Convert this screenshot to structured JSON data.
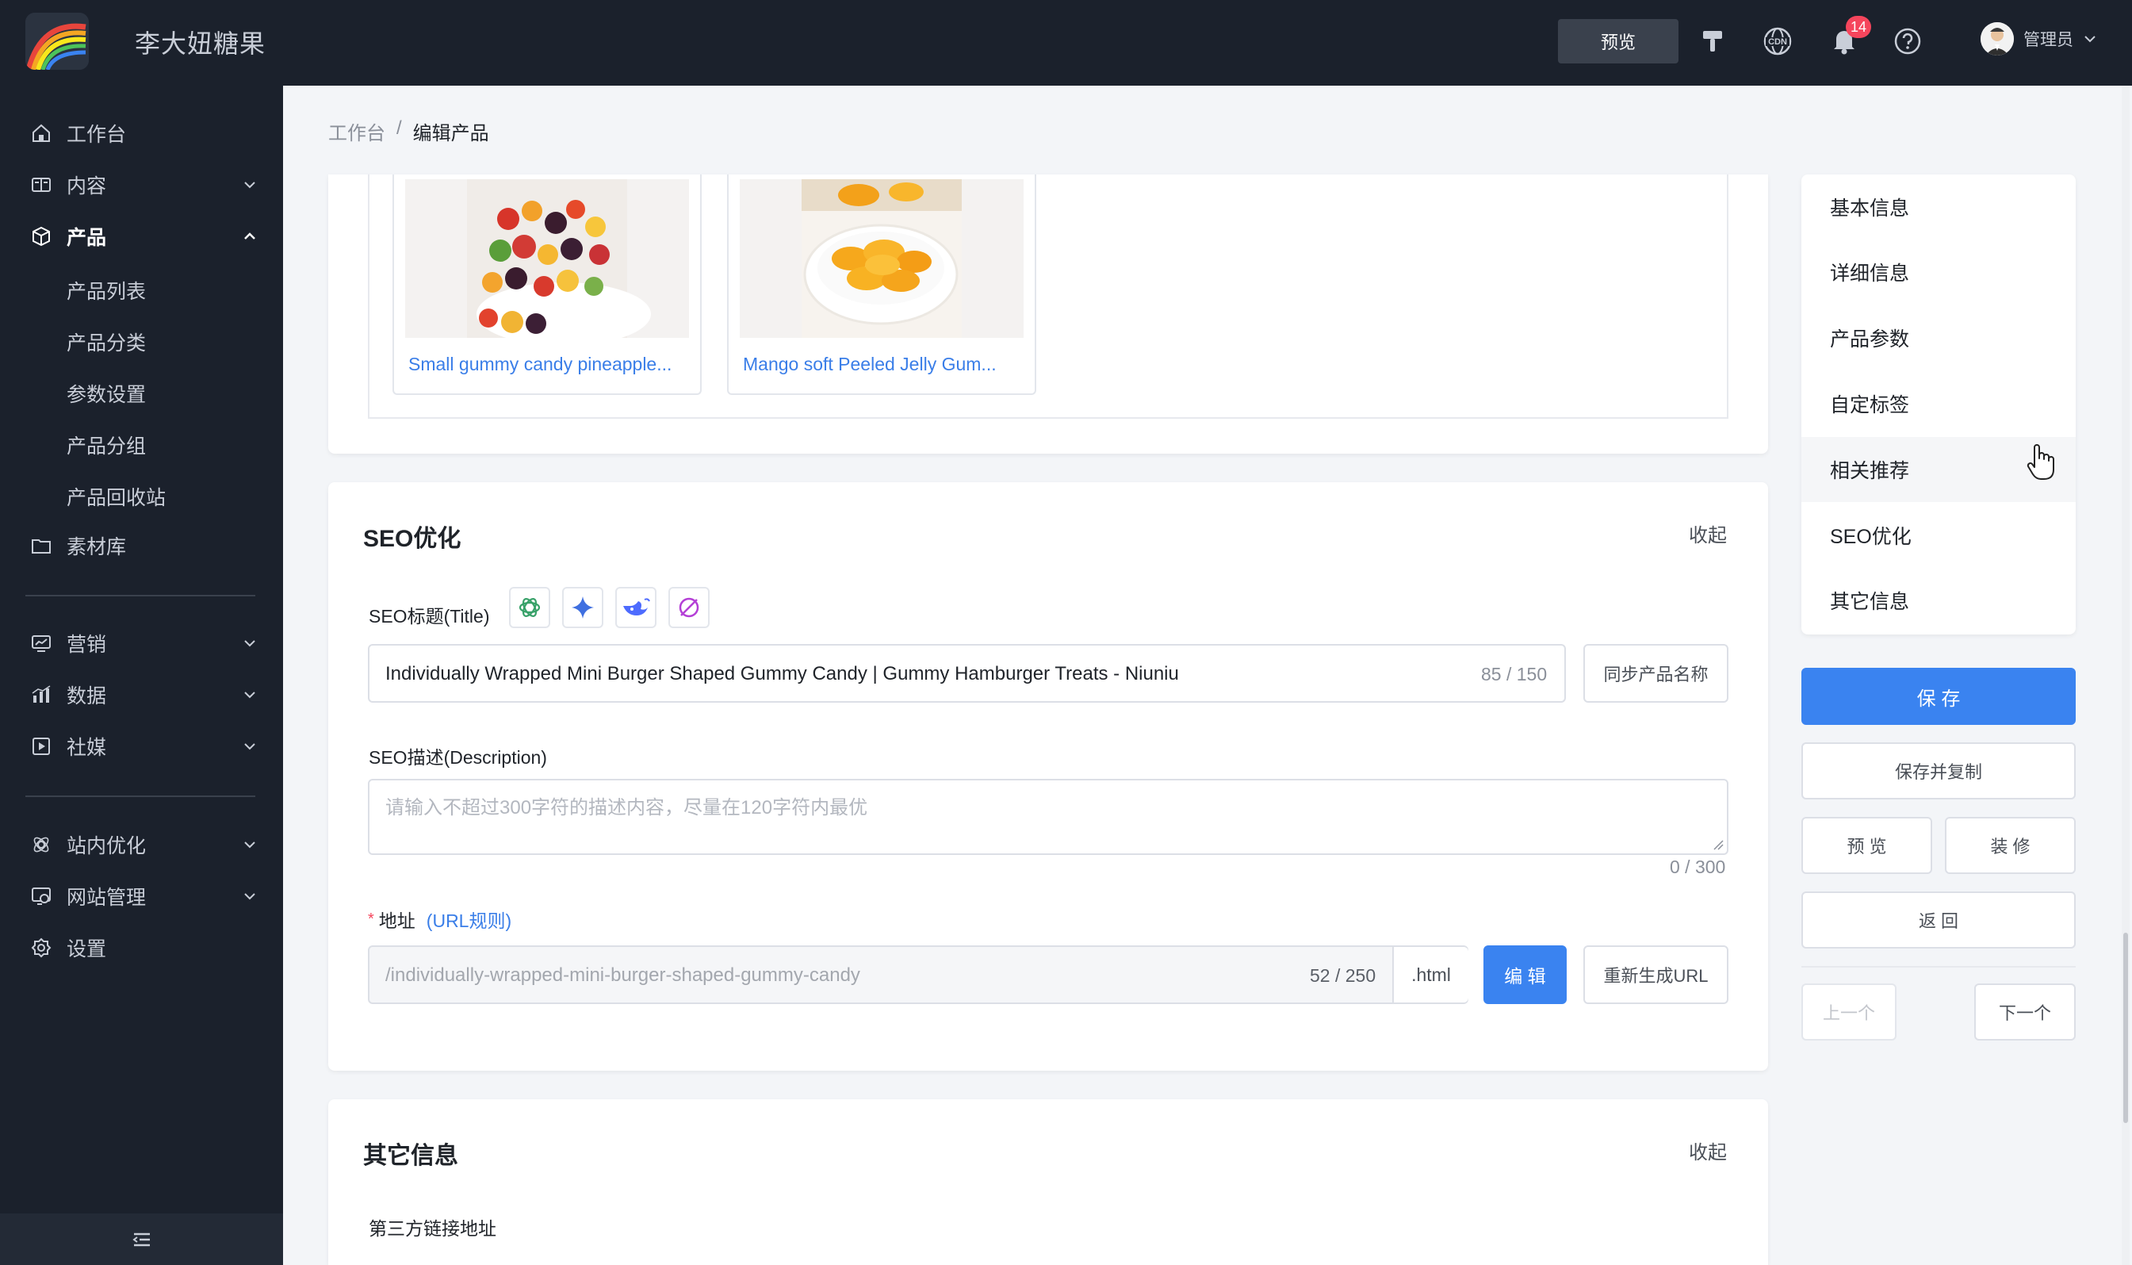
{
  "header": {
    "site_name": "李大妞糖果",
    "preview_label": "预览",
    "cdn_label": "CDN",
    "notification_count": "14",
    "user_name": "管理员"
  },
  "sidebar": {
    "items": [
      {
        "label": "工作台",
        "icon": "home-icon"
      },
      {
        "label": "内容",
        "icon": "content-icon"
      },
      {
        "label": "产品",
        "icon": "product-icon"
      },
      {
        "label": "素材库",
        "icon": "folder-icon"
      },
      {
        "label": "营销",
        "icon": "marketing-icon"
      },
      {
        "label": "数据",
        "icon": "chart-icon"
      },
      {
        "label": "社媒",
        "icon": "media-icon"
      },
      {
        "label": "站内优化",
        "icon": "seo-icon"
      },
      {
        "label": "网站管理",
        "icon": "website-icon"
      },
      {
        "label": "设置",
        "icon": "settings-icon"
      }
    ],
    "product_sub": [
      "产品列表",
      "产品分类",
      "参数设置",
      "产品分组",
      "产品回收站"
    ]
  },
  "breadcrumb": {
    "root": "工作台",
    "sep": "/",
    "current": "编辑产品"
  },
  "related_products": [
    {
      "name": "Small gummy candy pineapple..."
    },
    {
      "name": "Mango soft Peeled Jelly Gum..."
    }
  ],
  "seo": {
    "section_title": "SEO优化",
    "collapse_label": "收起",
    "title_label": "SEO标题(Title)",
    "title_value": "Individually Wrapped Mini Burger Shaped Gummy Candy | Gummy Hamburger Treats - Niuniu",
    "title_counter": "85 / 150",
    "sync_button": "同步产品名称",
    "desc_label": "SEO描述(Description)",
    "desc_placeholder": "请输入不超过300字符的描述内容，尽量在120字符内最优",
    "desc_counter": "0 / 300",
    "url_required_mark": "*",
    "url_label": "地址",
    "url_rule_link": "(URL规则)",
    "url_value": "/individually-wrapped-mini-burger-shaped-gummy-candy",
    "url_counter": "52 / 250",
    "url_suffix": ".html",
    "edit_button": "编 辑",
    "regen_button": "重新生成URL"
  },
  "other": {
    "section_title": "其它信息",
    "collapse_label": "收起",
    "third_party_label": "第三方链接地址"
  },
  "anchors": [
    "基本信息",
    "详细信息",
    "产品参数",
    "自定标签",
    "相关推荐",
    "SEO优化",
    "其它信息"
  ],
  "actions": {
    "save": "保 存",
    "save_copy": "保存并复制",
    "preview": "预 览",
    "decorate": "装 修",
    "back": "返 回",
    "prev": "上一个",
    "next": "下一个"
  },
  "colors": {
    "primary": "#3a83f0",
    "sidebar_bg": "#1b212c",
    "badge": "#f5455c",
    "link": "#3a7ee8"
  }
}
